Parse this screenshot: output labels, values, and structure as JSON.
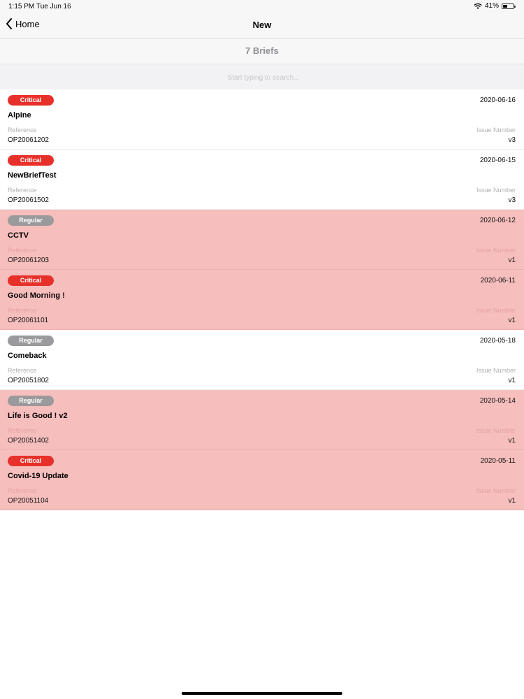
{
  "status_bar": {
    "time": "1:15 PM",
    "date": "Tue Jun 16",
    "battery": "41%",
    "battery_level": 0.41,
    "icons": [
      "wifi-icon",
      "battery-icon"
    ]
  },
  "nav": {
    "back_label": "Home",
    "title": "New"
  },
  "count_text": "7 Briefs",
  "search": {
    "placeholder": "Start typing to search...",
    "value": ""
  },
  "labels": {
    "reference": "Reference",
    "issue_number": "Issue Number"
  },
  "colors": {
    "critical": "#e8302b",
    "regular": "#9a9a9c",
    "tinted_row": "#f6bebc"
  },
  "briefs": [
    {
      "badge": "Critical",
      "date": "2020-06-16",
      "title": "Alpine",
      "reference": "OP20061202",
      "issue": "v3",
      "tinted": false
    },
    {
      "badge": "Critical",
      "date": "2020-06-15",
      "title": "NewBriefTest",
      "reference": "OP20061502",
      "issue": "v3",
      "tinted": false
    },
    {
      "badge": "Regular",
      "date": "2020-06-12",
      "title": "CCTV",
      "reference": "OP20061203",
      "issue": "v1",
      "tinted": true
    },
    {
      "badge": "Critical",
      "date": "2020-06-11",
      "title": "Good Morning !",
      "reference": "OP20061101",
      "issue": "v1",
      "tinted": true
    },
    {
      "badge": "Regular",
      "date": "2020-05-18",
      "title": "Comeback",
      "reference": "OP20051802",
      "issue": "v1",
      "tinted": false
    },
    {
      "badge": "Regular",
      "date": "2020-05-14",
      "title": "Life is Good ! v2",
      "reference": "OP20051402",
      "issue": "v1",
      "tinted": true
    },
    {
      "badge": "Critical",
      "date": "2020-05-11",
      "title": "Covid-19 Update",
      "reference": "OP20051104",
      "issue": "v1",
      "tinted": true
    }
  ]
}
